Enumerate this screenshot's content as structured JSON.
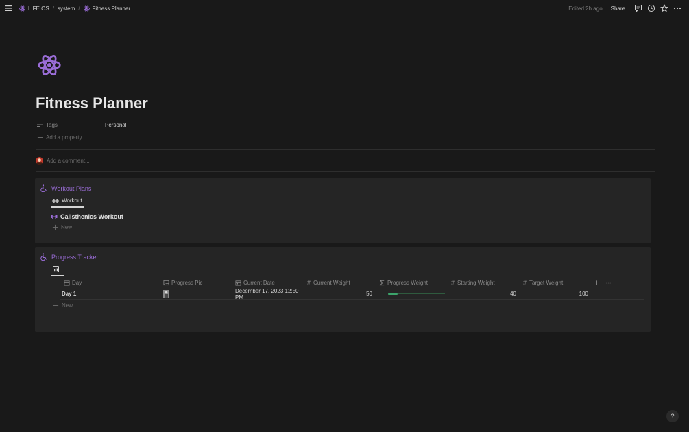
{
  "breadcrumb": {
    "items": [
      {
        "label": "LIFE OS"
      },
      {
        "label": "system"
      },
      {
        "label": "Fitness Planner"
      }
    ],
    "separator": "/"
  },
  "topbar": {
    "edited": "Edited 2h ago",
    "share": "Share"
  },
  "page": {
    "title": "Fitness Planner",
    "icon": "atom-icon",
    "accent_color": "#9a6dd7",
    "properties": [
      {
        "label": "Tags",
        "value": "Personal"
      }
    ],
    "add_property": "Add a property",
    "comment_placeholder": "Add a comment..."
  },
  "workout_plans": {
    "title": "Workout Plans",
    "tab": "Workout",
    "items": [
      {
        "label": "Calisthenics Workout"
      }
    ],
    "new_label": "New"
  },
  "progress_tracker": {
    "title": "Progress Tracker",
    "view_icon": "chart-icon",
    "columns": [
      {
        "label": "Day",
        "icon": "calendar-icon"
      },
      {
        "label": "Progress Pic",
        "icon": "image-icon"
      },
      {
        "label": "Current Date",
        "icon": "calendar-icon"
      },
      {
        "label": "Current Weight",
        "icon": "hash-icon"
      },
      {
        "label": "Progress Weight",
        "icon": "formula-icon"
      },
      {
        "label": "Starting Weight",
        "icon": "hash-icon"
      },
      {
        "label": "Target Weight",
        "icon": "hash-icon"
      }
    ],
    "rows": [
      {
        "day": "Day 1",
        "current_date": "December 17, 2023 12:50 PM",
        "current_weight": "50",
        "progress_fraction": 0.17,
        "starting_weight": "40",
        "target_weight": "100"
      }
    ],
    "new_label": "New"
  },
  "help": {
    "label": "?"
  }
}
